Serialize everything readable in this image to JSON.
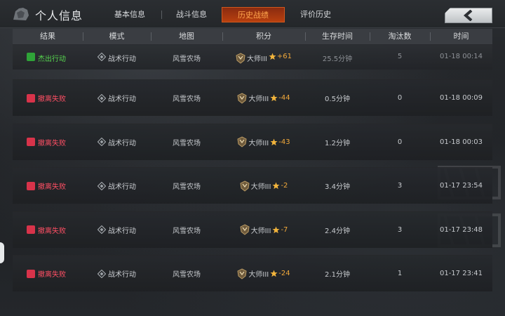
{
  "header": {
    "title": "个人信息",
    "tabs": [
      {
        "label": "基本信息",
        "active": false
      },
      {
        "label": "战斗信息",
        "active": false
      },
      {
        "label": "历史战绩",
        "active": true
      },
      {
        "label": "评价历史",
        "active": false
      }
    ],
    "back_icon": "chevron-left-icon",
    "accent_color": "#ffa64d"
  },
  "table": {
    "columns": [
      "结果",
      "模式",
      "地图",
      "积分",
      "生存时间",
      "淘汰数",
      "时间"
    ],
    "rows": [
      {
        "result": "杰出行动",
        "result_type": "success",
        "mode": "战术行动",
        "map": "风雪农场",
        "rank": "大师III",
        "score": "+61",
        "survival": "25.5分钟",
        "kills": "5",
        "time": "01-18 00:14"
      },
      {
        "result": "撤离失败",
        "result_type": "fail",
        "mode": "战术行动",
        "map": "风雪农场",
        "rank": "大师III",
        "score": "-44",
        "survival": "0.5分钟",
        "kills": "0",
        "time": "01-18 00:09"
      },
      {
        "result": "撤离失败",
        "result_type": "fail",
        "mode": "战术行动",
        "map": "风雪农场",
        "rank": "大师III",
        "score": "-43",
        "survival": "1.2分钟",
        "kills": "0",
        "time": "01-18 00:03"
      },
      {
        "result": "撤离失败",
        "result_type": "fail",
        "mode": "战术行动",
        "map": "风雪农场",
        "rank": "大师III",
        "score": "-2",
        "survival": "3.4分钟",
        "kills": "3",
        "time": "01-17 23:54"
      },
      {
        "result": "撤离失败",
        "result_type": "fail",
        "mode": "战术行动",
        "map": "风雪农场",
        "rank": "大师III",
        "score": "-7",
        "survival": "2.4分钟",
        "kills": "3",
        "time": "01-17 23:48"
      },
      {
        "result": "撤离失败",
        "result_type": "fail",
        "mode": "战术行动",
        "map": "风雪农场",
        "rank": "大师III",
        "score": "-24",
        "survival": "2.1分钟",
        "kills": "1",
        "time": "01-17 23:41"
      }
    ]
  },
  "colors": {
    "success": "#57d64f",
    "fail": "#ff4f64",
    "score": "#f2a93b"
  }
}
